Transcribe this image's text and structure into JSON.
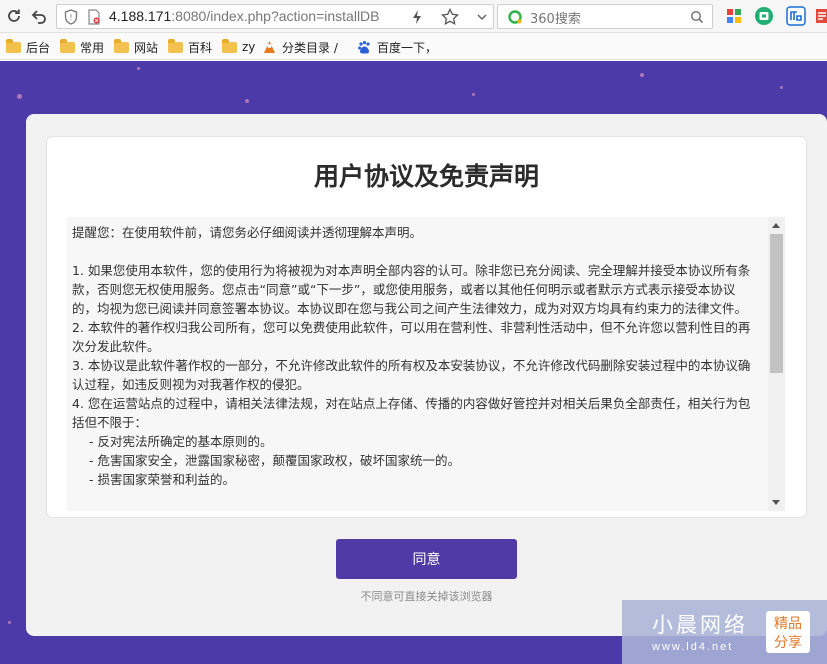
{
  "browser": {
    "url_host": "4.188.171",
    "url_rest": ":8080/index.php?action=installDB",
    "search_placeholder": "360搜索",
    "bookmarks": [
      "后台",
      "常用",
      "网站",
      "百科",
      "zy",
      "分类目录 /",
      "百度一下，"
    ]
  },
  "page": {
    "title": "用户协议及免责声明",
    "agreement_lines": [
      "提醒您：在使用软件前，请您务必仔细阅读并透彻理解本声明。",
      "",
      "1. 如果您使用本软件，您的使用行为将被视为对本声明全部内容的认可。除非您已充分阅读、完全理解并接受本协议所有条款，否则您无权使用服务。您点击“同意”或“下一步”，或您使用服务，或者以其他任何明示或者默示方式表示接受本协议的，均视为您已阅读并同意签署本协议。本协议即在您与我公司之间产生法律效力，成为对双方均具有约束力的法律文件。",
      "2. 本软件的著作权归我公司所有，您可以免费使用此软件，可以用在营利性、非营利性活动中，但不允许您以营利性目的再次分发此软件。",
      "3. 本协议是此软件著作权的一部分，不允许修改此软件的所有权及本安装协议，不允许修改代码删除安装过程中的本协议确认过程，如违反则视为对我著作权的侵犯。",
      "4. 您在运营站点的过程中，请相关法律法规，对在站点上存储、传播的内容做好管控并对相关后果负全部责任，相关行为包括但不限于：",
      "- 反对宪法所确定的基本原则的。",
      "- 危害国家安全，泄露国家秘密，颠覆国家政权，破坏国家统一的。",
      "- 损害国家荣誉和利益的。"
    ],
    "agree_label": "同意",
    "hint": "不同意可直接关掉该浏览器"
  },
  "watermark": {
    "name": "小晨网络",
    "site": "www.ld4.net",
    "badge_top": "精品",
    "badge_bottom": "分享"
  },
  "colors": {
    "page_bg": "#4b3aa8",
    "button": "#4f3aa6"
  }
}
